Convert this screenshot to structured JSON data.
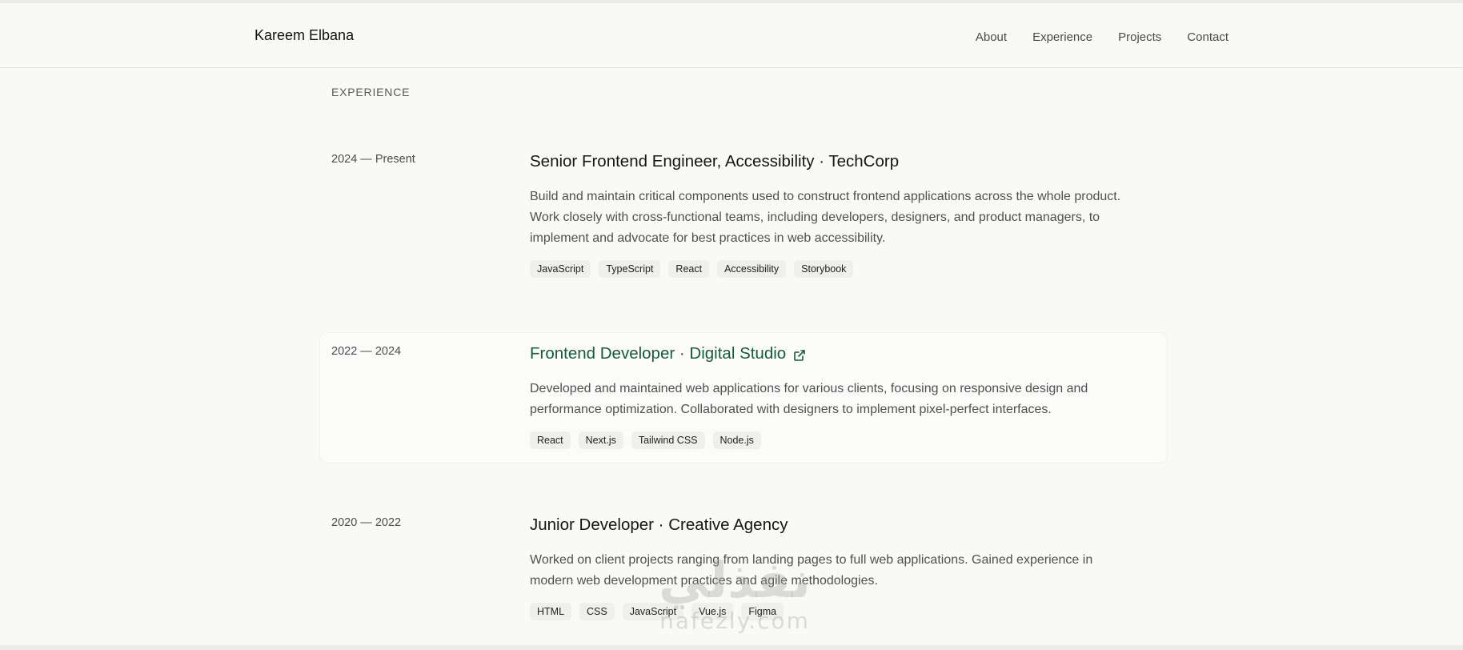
{
  "header": {
    "brand": "Kareem Elbana",
    "nav": [
      "About",
      "Experience",
      "Projects",
      "Contact"
    ]
  },
  "section": {
    "label": "EXPERIENCE"
  },
  "jobs": [
    {
      "period": "2024 — Present",
      "title": "Senior Frontend Engineer, Accessibility · TechCorp",
      "description": "Build and maintain critical components used to construct frontend applications across the whole product. Work closely with cross-functional teams, including developers, designers, and product managers, to implement and advocate for best practices in web accessibility.",
      "tags": [
        "JavaScript",
        "TypeScript",
        "React",
        "Accessibility",
        "Storybook"
      ]
    },
    {
      "period": "2022 — 2024",
      "title": "Frontend Developer · Digital Studio",
      "description": "Developed and maintained web applications for various clients, focusing on responsive design and performance optimization. Collaborated with designers to implement pixel-perfect interfaces.",
      "tags": [
        "React",
        "Next.js",
        "Tailwind CSS",
        "Node.js"
      ],
      "external_icon": "external-link-icon"
    },
    {
      "period": "2020 — 2022",
      "title": "Junior Developer · Creative Agency",
      "description": "Worked on client projects ranging from landing pages to full web applications. Gained experience in modern web development practices and agile methodologies.",
      "tags": [
        "HTML",
        "CSS",
        "JavaScript",
        "Vue.js",
        "Figma"
      ]
    }
  ],
  "watermark": {
    "arabic": "نفذلي",
    "latin": "nafezly.com"
  },
  "colors": {
    "background": "#f9f9f6",
    "accent_link": "#155c3b",
    "tag_bg": "#efefeb",
    "text_muted": "#505050"
  }
}
